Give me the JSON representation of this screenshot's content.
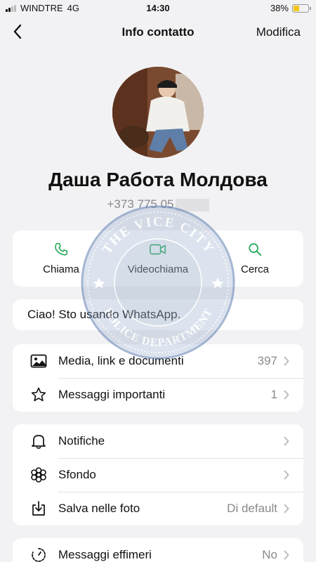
{
  "status_bar": {
    "carrier": "WINDTRE",
    "network": "4G",
    "time": "14:30",
    "battery_percent": "38%",
    "battery_level": 0.38,
    "battery_color": "#f5c518"
  },
  "nav": {
    "back_icon": "chevron-left-icon",
    "title": "Info contatto",
    "edit_label": "Modifica"
  },
  "contact": {
    "name": "Даша Работа Молдова",
    "phone": "+373 775 05"
  },
  "actions": [
    {
      "label": "Chiama",
      "icon": "phone-icon"
    },
    {
      "label": "Videochiama",
      "icon": "video-icon"
    },
    {
      "label": "Cerca",
      "icon": "search-icon"
    }
  ],
  "about": "Ciao! Sto usando WhatsApp.",
  "group1": [
    {
      "label": "Media, link e documenti",
      "value": "397",
      "icon": "image-icon"
    },
    {
      "label": "Messaggi importanti",
      "value": "1",
      "icon": "star-icon"
    }
  ],
  "group2": [
    {
      "label": "Notifiche",
      "value": "",
      "icon": "bell-icon"
    },
    {
      "label": "Sfondo",
      "value": "",
      "icon": "flower-icon"
    },
    {
      "label": "Salva nelle foto",
      "value": "Di default",
      "icon": "download-icon"
    }
  ],
  "group3": [
    {
      "label": "Messaggi effimeri",
      "value": "No",
      "icon": "timer-icon"
    }
  ],
  "watermark": {
    "top_text": "THE VICE CITY",
    "bottom_text": "POLICE DEPARTMENT"
  },
  "colors": {
    "accent": "#1fa855",
    "background": "#f2f2f4",
    "secondary_text": "#8a8a8e"
  }
}
